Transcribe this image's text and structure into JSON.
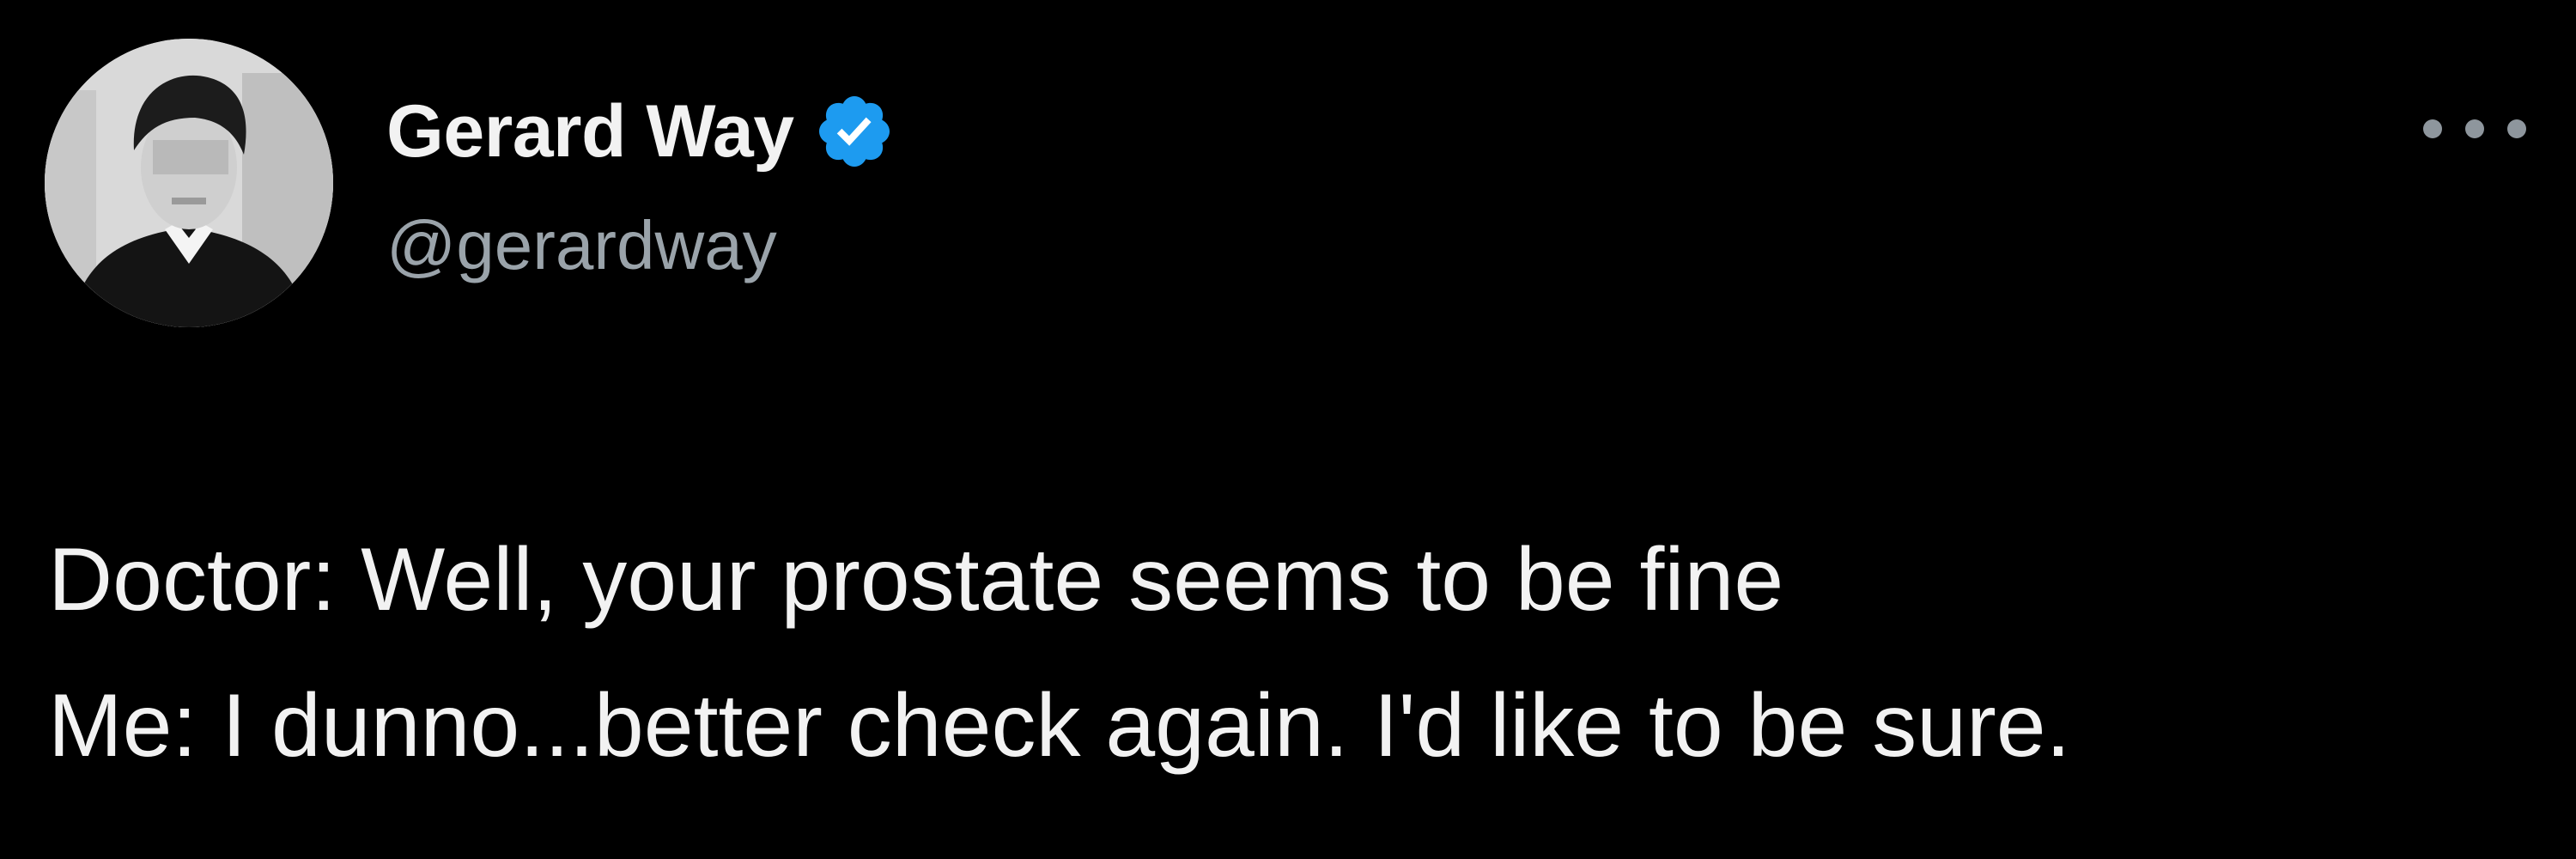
{
  "author": {
    "display_name": "Gerard Way",
    "handle": "@gerardway",
    "verified": true,
    "avatar_icon": "profile-photo",
    "verified_icon": "verified-badge-icon"
  },
  "tweet": {
    "lines": [
      "Doctor: Well, your prostate seems to be fine",
      "Me: I dunno...better check again. I'd like to be sure."
    ]
  },
  "menu": {
    "icon": "more-options-icon"
  },
  "colors": {
    "background": "#000000",
    "text": "#f2f2f2",
    "handle": "#9aa3aa",
    "verified_badge": "#1d9bf0"
  }
}
